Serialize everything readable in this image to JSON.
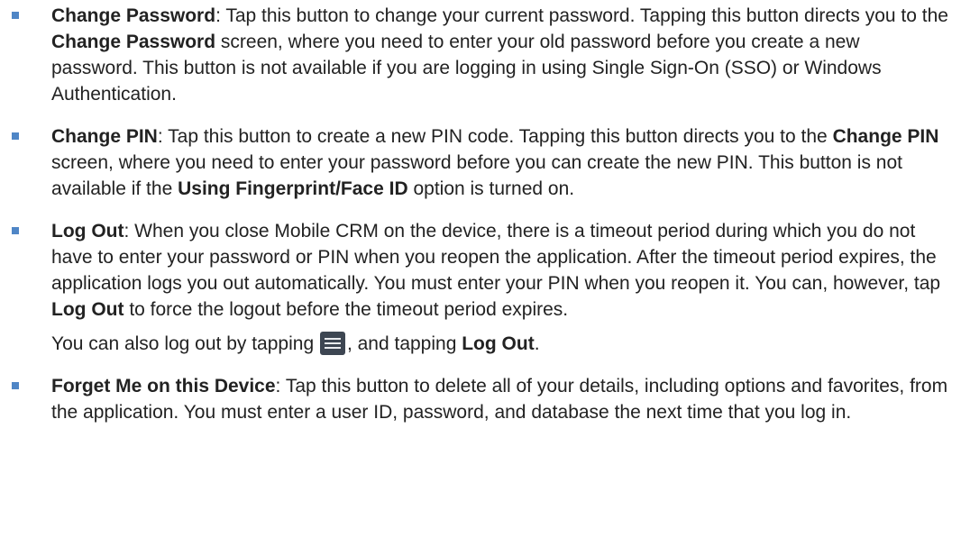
{
  "colors": {
    "bullet": "#4f86c6",
    "text": "#222222",
    "menu_icon_bg": "#3d4652"
  },
  "items": [
    {
      "term": "Change Password",
      "text_1": ": Tap this button to change your current password. Tapping this button directs you to the ",
      "bold_1": "Change Password",
      "text_2": " screen, where you need to enter your old password before you create a new password. This button is not available if you are logging in using Single Sign-On (SSO) or Windows Authentication."
    },
    {
      "term": "Change PIN",
      "text_1": ": Tap this button to create a new PIN code. Tapping this button directs you to the ",
      "bold_1": "Change PIN",
      "text_2": " screen, where you need to enter your password before you can create the new PIN. This button is not available if the ",
      "bold_2": "Using Fingerprint/Face ID",
      "text_3": " option is turned on."
    },
    {
      "term": "Log Out",
      "text_1": ": When you close Mobile CRM on the device, there is a timeout period during which you do not have to enter your password or PIN when you reopen the application. After the timeout period expires, the application logs you out automatically. You must enter your PIN when you reopen it. You can, however, tap ",
      "bold_1": "Log Out",
      "text_2": " to force the logout before the timeout period expires.",
      "extra_text_1": "You can also log out by tapping ",
      "extra_icon": "hamburger-menu-icon",
      "extra_text_2": ", and tapping ",
      "extra_bold": "Log Out",
      "extra_text_3": "."
    },
    {
      "term": "Forget Me on this Device",
      "text_1": ": Tap this button to delete all of your details, including options and favorites, from the application. You must enter a user ID, password, and database the next time that you log in."
    }
  ]
}
